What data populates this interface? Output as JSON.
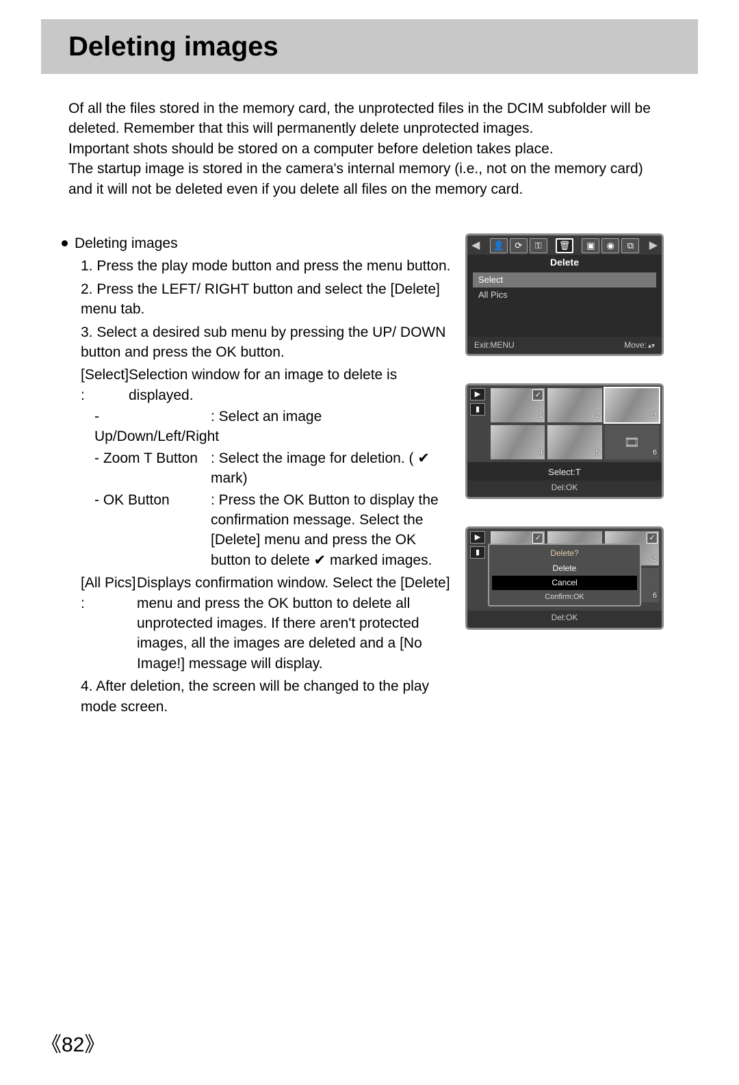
{
  "page_number_display": "《82》",
  "title": "Deleting images",
  "intro": [
    "Of all the files stored in the memory card, the unprotected files in the DCIM subfolder will be deleted. Remember that this will permanently delete unprotected images.",
    "Important shots should be stored on a computer before deletion takes place.",
    "The startup image is stored in the camera's internal memory (i.e., not on the memory card) and it will not be deleted even if you delete all files on the memory card."
  ],
  "section_heading": "Deleting images",
  "steps": {
    "s1": "1. Press the play mode button and press the menu button.",
    "s2": "2. Press the LEFT/ RIGHT button and select the [Delete] menu tab.",
    "s3": "3. Select a desired sub menu by pressing the UP/ DOWN button and press the OK button.",
    "s3_select_label": "[Select] :",
    "s3_select_text": "Selection window for an image to delete is displayed.",
    "s3_updown_key": "- Up/Down/Left/Right",
    "s3_updown_val": ": Select an image",
    "s3_zoom_key": "- Zoom T Button",
    "s3_zoom_val": ": Select the image for deletion. ( ✔ mark)",
    "s3_ok_key": "- OK Button",
    "s3_ok_val": ": Press the OK Button to display the confirmation message. Select the [Delete] menu and press the OK button to delete ✔ marked images.",
    "s3_allpics_label": "[All Pics] :",
    "s3_allpics_text": "Displays confirmation window. Select the [Delete] menu and press the OK button to delete all unprotected images. If there aren't protected images, all the images are deleted and a [No Image!] message will display.",
    "s4": "4. After deletion, the screen will be changed to the play mode screen."
  },
  "screens": {
    "menu": {
      "title": "Delete",
      "items": [
        "Select",
        "All Pics"
      ],
      "exit": "Exit:MENU",
      "move": "Move:"
    },
    "select": {
      "thumb_numbers": [
        "1",
        "2",
        "3",
        "4",
        "5",
        "6"
      ],
      "mid": "Select:T",
      "foot": "Del:OK"
    },
    "confirm": {
      "prompt": "Delete?",
      "opt_delete": "Delete",
      "opt_cancel": "Cancel",
      "confirm": "Confirm:OK",
      "foot": "Del:OK",
      "thumb3": "3",
      "thumb6": "6"
    }
  }
}
